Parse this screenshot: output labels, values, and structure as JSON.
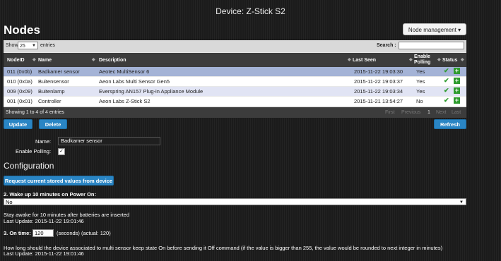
{
  "header": {
    "device_title": "Device: Z-Stick S2",
    "nodes_heading": "Nodes",
    "node_management": "Node management ▾"
  },
  "table": {
    "show_label": "Show",
    "show_value": "25",
    "entries_label": "entries",
    "search_label": "Search :",
    "columns": [
      "NodeID",
      "Name",
      "Description",
      "Last Seen",
      "Enable Polling",
      "Status"
    ],
    "rows": [
      {
        "id": "011 (0x0b)",
        "name": "Badkamer sensor",
        "desc": "Aeotec MultiSensor 6",
        "seen": "2015-11-22 19:03:30",
        "poll": "Yes"
      },
      {
        "id": "010 (0x0a)",
        "name": "Buitensensor",
        "desc": "Aeon Labs Multi Sensor Gen5",
        "seen": "2015-11-22 19:03:37",
        "poll": "Yes"
      },
      {
        "id": "009 (0x09)",
        "name": "Buitenlamp",
        "desc": "Everspring AN157 Plug-in Appliance Module",
        "seen": "2015-11-22 19:03:34",
        "poll": "Yes"
      },
      {
        "id": "001 (0x01)",
        "name": "Controller",
        "desc": "Aeon Labs Z-Stick S2",
        "seen": "2015-11-21 13:54:27",
        "poll": "No"
      }
    ],
    "info": "Showing 1 to 4 of 4 entries",
    "pager": {
      "first": "First",
      "previous": "Previous",
      "page": "1",
      "next": "Next",
      "last": "Last"
    }
  },
  "buttons": {
    "update": "Update",
    "delete": "Delete",
    "refresh": "Refresh"
  },
  "form": {
    "name_label": "Name:",
    "name_value": "Badkamer sensor",
    "polling_label": "Enable Polling:",
    "polling_checked": "✓"
  },
  "config": {
    "heading": "Configuration",
    "request_button": "Request current stored values from device",
    "param2_title": "2. Wake up 10 minutes on Power On:",
    "param2_value": "No",
    "param2_desc": "Stay awake for 10 minutes after batteries are inserted",
    "param2_update": "Last Update: 2015-11-22 19:01:46",
    "param3_label": "3. On time:",
    "param3_value": "120",
    "param3_suffix": "(seconds) (actual: 120)",
    "param3_desc": "How long should the device associated to multi sensor keep state On before sending it Off command (if the value is bigger than 255, the value would be rounded to next integer in minutes)",
    "param3_update": "Last Update: 2015-11-22 19:01:46"
  },
  "colors": {
    "accent": "#2a85c4",
    "selected_row": "#a4b3d6",
    "row_alt": "#e1e4f4",
    "status_ok": "#2e9b2e"
  }
}
